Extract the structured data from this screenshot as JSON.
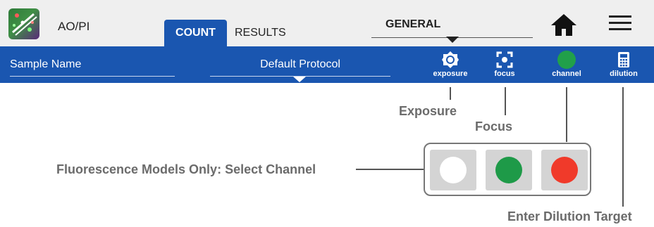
{
  "header": {
    "app_title": "AO/PI",
    "tabs": [
      {
        "label": "COUNT",
        "active": true
      },
      {
        "label": "RESULTS",
        "active": false
      }
    ],
    "general_label": "GENERAL",
    "home_icon": "home-icon",
    "menu_icon": "hamburger-menu-icon"
  },
  "toolbar": {
    "sample_name_placeholder": "Sample Name",
    "protocol_value": "Default Protocol",
    "tools": [
      {
        "label": "exposure",
        "icon": "sun-icon"
      },
      {
        "label": "focus",
        "icon": "focus-icon"
      },
      {
        "label": "channel",
        "icon": "channel-dot-icon",
        "color": "#21a04a"
      },
      {
        "label": "dilution",
        "icon": "calculator-icon"
      }
    ]
  },
  "callouts": {
    "exposure": "Exposure",
    "focus": "Focus",
    "channel": "Fluorescence Models Only: Select Channel",
    "dilution": "Enter Dilution Target"
  },
  "channel_panel": {
    "options": [
      {
        "color": "#ffffff"
      },
      {
        "color": "#1e9a48"
      },
      {
        "color": "#f03a2a"
      }
    ]
  },
  "colors": {
    "primary": "#1a56b0",
    "header_bg": "#efefef",
    "callout_text": "#6b6b6b"
  }
}
